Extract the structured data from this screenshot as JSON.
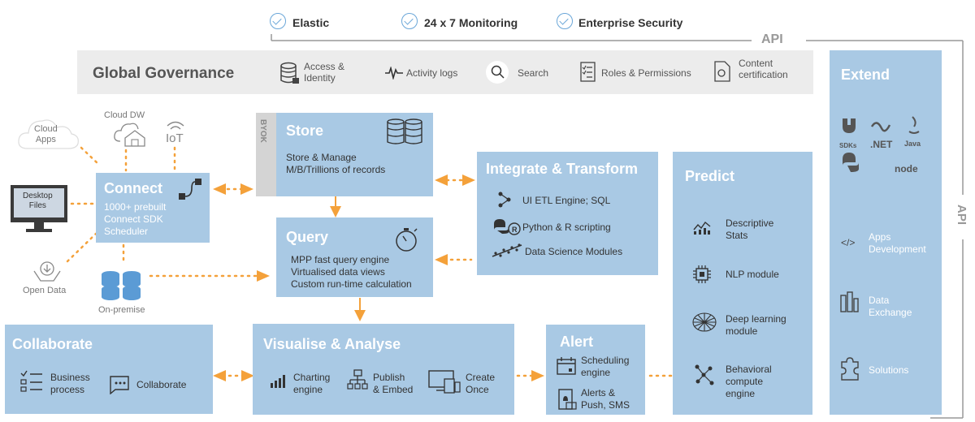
{
  "features": [
    "Elastic",
    "24 x 7 Monitoring",
    "Enterprise Security"
  ],
  "api_label": "API",
  "governance": {
    "title": "Global Governance",
    "items": [
      "Access &\nIdentity",
      "Activity logs",
      "Search",
      "Roles & Permissions",
      "Content\ncertification"
    ]
  },
  "sources": {
    "cloud_apps": "Cloud\nApps",
    "cloud_dw": "Cloud DW",
    "iot": "IoT",
    "desktop_files": "Desktop\nFiles",
    "open_data": "Open Data",
    "on_premise": "On-premise"
  },
  "connect": {
    "title": "Connect",
    "lines": [
      "1000+ prebuilt",
      "Connect SDK",
      "Scheduler"
    ]
  },
  "byok": "BYOK",
  "store": {
    "title": "Store",
    "lines": [
      "Store & Manage",
      "M/B/Trillions of records"
    ]
  },
  "query": {
    "title": "Query",
    "lines": [
      "MPP fast query engine",
      "Virtualised data views",
      "Custom run-time calculation"
    ]
  },
  "integrate": {
    "title": "Integrate & Transform",
    "items": [
      "UI ETL Engine; SQL",
      "Python & R scripting",
      "Data Science Modules"
    ]
  },
  "predict": {
    "title": "Predict",
    "items": [
      "Descriptive\nStats",
      "NLP module",
      "Deep learning\nmodule",
      "Behavioral\ncompute\nengine"
    ]
  },
  "extend": {
    "title": "Extend",
    "sdk_labels": [
      "SDKs",
      ".NET",
      "Java",
      "node"
    ],
    "items": [
      "Apps\nDevelopment",
      "Data\nExchange",
      "Solutions"
    ]
  },
  "collaborate": {
    "title": "Collaborate",
    "items": [
      "Business\nprocess",
      "Collaborate"
    ]
  },
  "visualise": {
    "title": "Visualise & Analyse",
    "items": [
      "Charting\nengine",
      "Publish\n& Embed",
      "Create\nOnce"
    ]
  },
  "alert": {
    "title": "Alert",
    "items": [
      "Scheduling\nengine",
      "Alerts &\nPush, SMS"
    ]
  },
  "colors": {
    "box": "#a9c9e4",
    "arrow": "#f4a13a",
    "check": "#6aa6d8"
  }
}
